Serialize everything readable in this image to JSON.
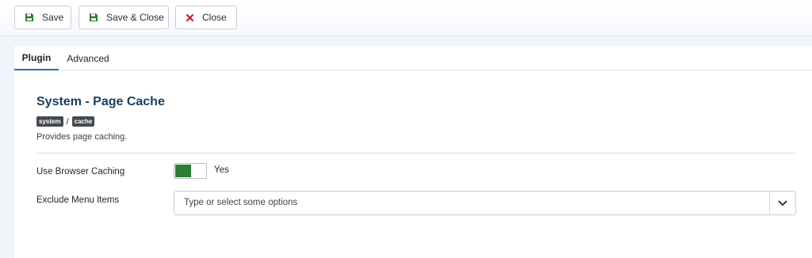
{
  "toolbar": {
    "save_label": "Save",
    "save_close_label": "Save & Close",
    "close_label": "Close"
  },
  "tabs": [
    {
      "label": "Plugin",
      "active": true
    },
    {
      "label": "Advanced",
      "active": false
    }
  ],
  "plugin": {
    "title": "System - Page Cache",
    "badges": [
      "system",
      "cache"
    ],
    "separator": "/",
    "description": "Provides page caching."
  },
  "fields": {
    "browser_caching": {
      "label": "Use Browser Caching",
      "value_text": "Yes"
    },
    "exclude_menu": {
      "label": "Exclude Menu Items",
      "placeholder": "Type or select some options"
    }
  },
  "colors": {
    "save_icon": "#2f7d32",
    "close_icon": "#c0212b",
    "active_tab": "#2a69b8",
    "switch_on": "#2f7d32"
  },
  "icons": {
    "save": "floppy-disk-icon",
    "save_close": "floppy-disk-icon",
    "close": "close-x-icon",
    "dropdown": "chevron-down-icon"
  }
}
